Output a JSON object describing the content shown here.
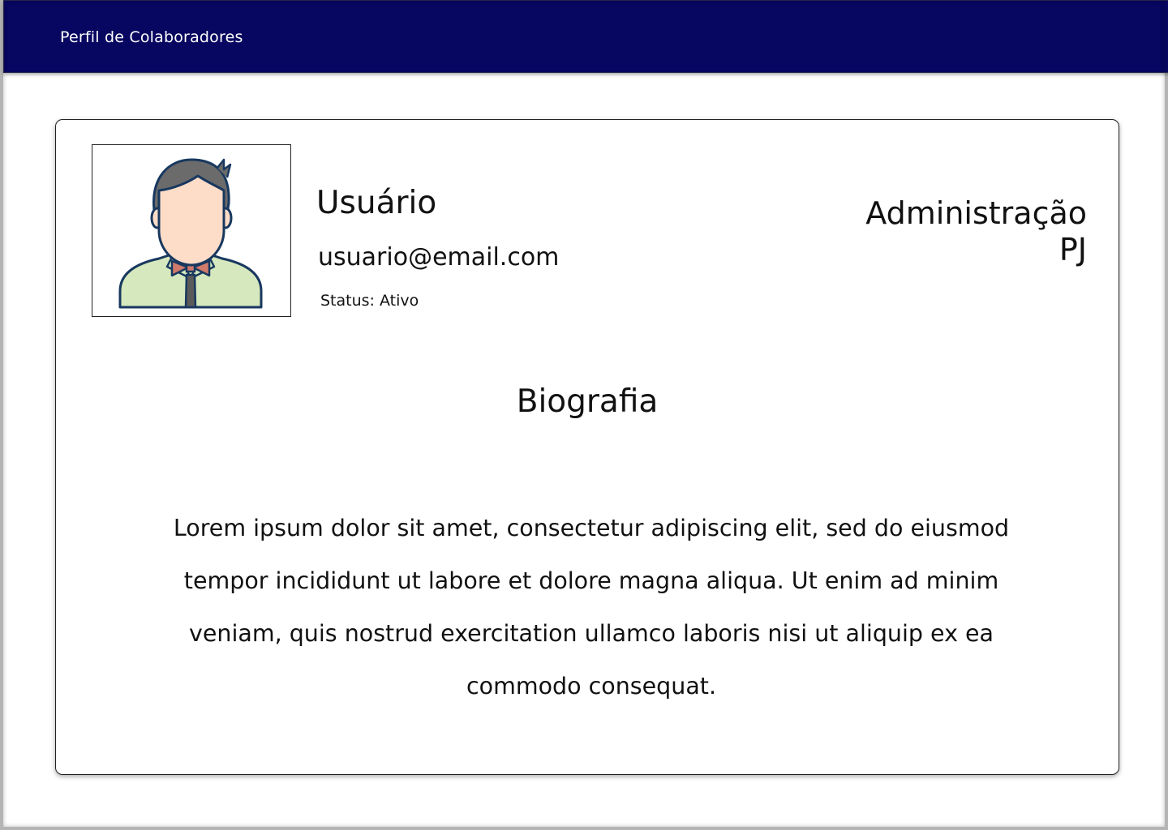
{
  "header": {
    "title": "Perfil de Colaboradores",
    "background_color": "#070660"
  },
  "profile": {
    "avatar_icon": "user-avatar-icon",
    "name": "Usuário",
    "email": "usuario@email.com",
    "status": "Status: Ativo",
    "role_line1": "Administração",
    "role_line2": "PJ"
  },
  "biography": {
    "title": "Biografia",
    "text": "Lorem ipsum dolor sit amet, consectetur adipiscing elit, sed do eiusmod tempor incididunt ut labore et dolore magna aliqua. Ut enim ad minim veniam, quis nostrud exercitation ullamco laboris nisi ut aliquip ex ea commodo consequat."
  }
}
